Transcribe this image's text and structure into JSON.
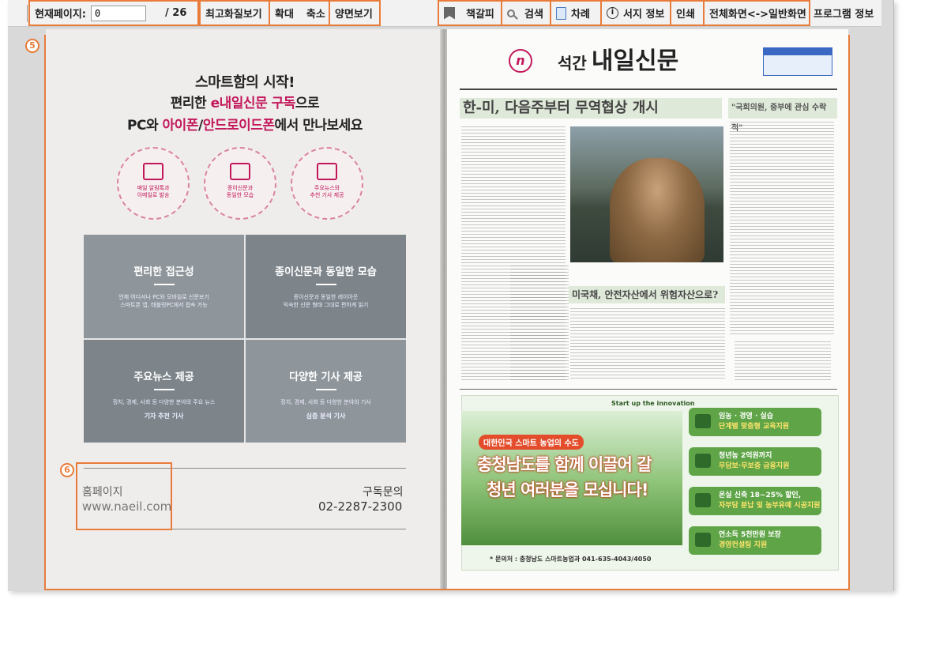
{
  "toolbar": {
    "current_page_label": "현재페이지:",
    "current_page_value": "0",
    "total_pages": "/ 26",
    "best_quality": "최고화질보기",
    "zoom_in": "확대",
    "zoom_out": "축소",
    "two_page": "양면보기",
    "bookmark": "책갈피",
    "search": "검색",
    "contents": "차례",
    "info": "서지 정보",
    "print": "인쇄",
    "fullscreen": "전체화면<->일반화면",
    "program_info": "프로그램 정보"
  },
  "annotations": {
    "viewer_number": "5",
    "homepage_number": "6"
  },
  "left_page": {
    "headline_1": "스마트함의 시작!",
    "headline_2a": "편리한 ",
    "headline_2b": "e내일신문 구독",
    "headline_2c": "으로",
    "headline_3a": "PC와 ",
    "headline_3b": "아이폰",
    "headline_3c": "/",
    "headline_3d": "안드로이드폰",
    "headline_3e": "에서 만나보세요",
    "features": [
      "매일 알림톡과\n이메일로 발송",
      "종이신문과\n동일한 모습",
      "주요뉴스와\n추천 기사 제공"
    ],
    "grid": [
      {
        "title": "편리한 접근성",
        "desc": "언제 어디서나 PC와 모바일로 신문보기",
        "desc2": "스마트폰 앱, 태블릿PC에서 접속 가능"
      },
      {
        "title": "종이신문과 동일한 모습",
        "desc": "종이신문과 동일한 레이아웃",
        "desc2": "익숙한 신문 형태 그대로 편하게 읽기"
      },
      {
        "title": "주요뉴스 제공",
        "desc": "정치, 경제, 사회 등 다양한 분야의 주요 뉴스",
        "desc2": "기자 추천 기사"
      },
      {
        "title": "다양한 기사 제공",
        "desc": "정치, 경제, 사회 등 다양한 분야의 기사",
        "desc2": "심층 분석 기사"
      }
    ],
    "homepage_label": "홈페이지",
    "homepage_url": "www.naeil.com",
    "subscribe_label": "구독문의",
    "subscribe_phone": "02-2287-2300"
  },
  "right_page": {
    "masthead_small": "석간",
    "masthead": "내일신문",
    "logo": "n",
    "top_headline": "한-미, 다음주부터 무역협상 개시",
    "side_headline": "\"국회의원, 중부에 관심 수락적\"",
    "sub_headline": "미국채, 안전자산에서 위험자산으로?",
    "ad_start": "Start up the innovation",
    "ad_badge": "대한민국 스마트 농업의 수도",
    "ad_line1": "충청남도를 함께 이끌어 갈",
    "ad_line2": "청년 여러분을 모십니다!",
    "ad_pills": [
      {
        "text": "임농 · 경영 · 실습",
        "hl": "단계별 맞춤형 교육지원"
      },
      {
        "text": "청년농 2억원까지",
        "hl": "무담보·무보증 금융지원"
      },
      {
        "text": "온실 신축 18~25% 할인,",
        "hl": "자부담 분납 및 농부유예 시공지원"
      },
      {
        "text": "연소득 5천만원 보장",
        "hl": "경영컨설팅 지원"
      }
    ],
    "ad_footer": "* 문의처 : 충청남도 스마트농업과 041-635-4043/4050"
  }
}
